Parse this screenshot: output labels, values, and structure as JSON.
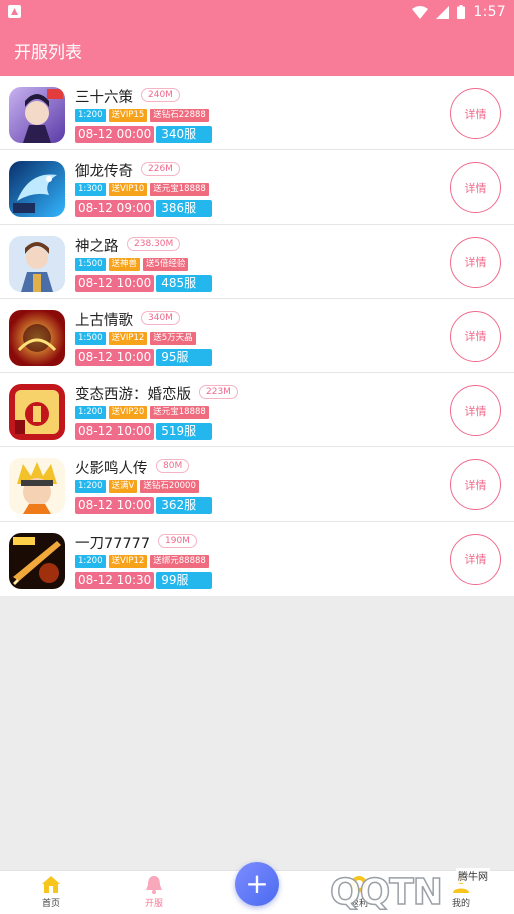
{
  "status_bar": {
    "time": "1:57"
  },
  "app_bar": {
    "title": "开服列表"
  },
  "games": [
    {
      "name": "三十六策",
      "size": "240M",
      "tags": [
        {
          "text": "1:200",
          "color": "blue"
        },
        {
          "text": "送VIP15",
          "color": "orange"
        },
        {
          "text": "送钻石22888",
          "color": "red"
        }
      ],
      "date": "08-12 00:00",
      "server": "340服",
      "detail_label": "详情"
    },
    {
      "name": "御龙传奇",
      "size": "226M",
      "tags": [
        {
          "text": "1:300",
          "color": "blue"
        },
        {
          "text": "送VIP10",
          "color": "orange"
        },
        {
          "text": "送元宝18888",
          "color": "red"
        }
      ],
      "date": "08-12 09:00",
      "server": "386服",
      "detail_label": "详情"
    },
    {
      "name": "神之路",
      "size": "238.30M",
      "tags": [
        {
          "text": "1:500",
          "color": "blue"
        },
        {
          "text": "送神兽",
          "color": "orange"
        },
        {
          "text": "送5倍经验",
          "color": "red"
        }
      ],
      "date": "08-12 10:00",
      "server": "485服",
      "detail_label": "详情"
    },
    {
      "name": "上古情歌",
      "size": "340M",
      "tags": [
        {
          "text": "1:500",
          "color": "blue"
        },
        {
          "text": "送VIP12",
          "color": "orange"
        },
        {
          "text": "送5万天晶",
          "color": "red"
        }
      ],
      "date": "08-12 10:00",
      "server": "95服",
      "detail_label": "详情"
    },
    {
      "name": "变态西游：婚恋版",
      "size": "223M",
      "tags": [
        {
          "text": "1:200",
          "color": "blue"
        },
        {
          "text": "送VIP20",
          "color": "orange"
        },
        {
          "text": "送元宝18888",
          "color": "red"
        }
      ],
      "date": "08-12 10:00",
      "server": "519服",
      "detail_label": "详情"
    },
    {
      "name": "火影鸣人传",
      "size": "80M",
      "tags": [
        {
          "text": "1:200",
          "color": "blue"
        },
        {
          "text": "送满V",
          "color": "orange"
        },
        {
          "text": "送钻石20000",
          "color": "red"
        }
      ],
      "date": "08-12 10:00",
      "server": "362服",
      "detail_label": "详情"
    },
    {
      "name": "一刀77777",
      "size": "190M",
      "tags": [
        {
          "text": "1:200",
          "color": "blue"
        },
        {
          "text": "送VIP12",
          "color": "orange"
        },
        {
          "text": "送绑元88888",
          "color": "red"
        }
      ],
      "date": "08-12 10:30",
      "server": "99服",
      "detail_label": "详情"
    }
  ],
  "bottom_nav": {
    "home": "首页",
    "kaifu": "开服",
    "fab": "+",
    "fanli": "返利",
    "mine": "我的"
  },
  "watermark": {
    "text": "QQTN",
    "brand": "腾牛网"
  },
  "colors": {
    "accent": "#f87c98",
    "blue_tag": "#23b7ee",
    "orange_tag": "#f7a21b",
    "red_tag": "#ef6c7f"
  }
}
